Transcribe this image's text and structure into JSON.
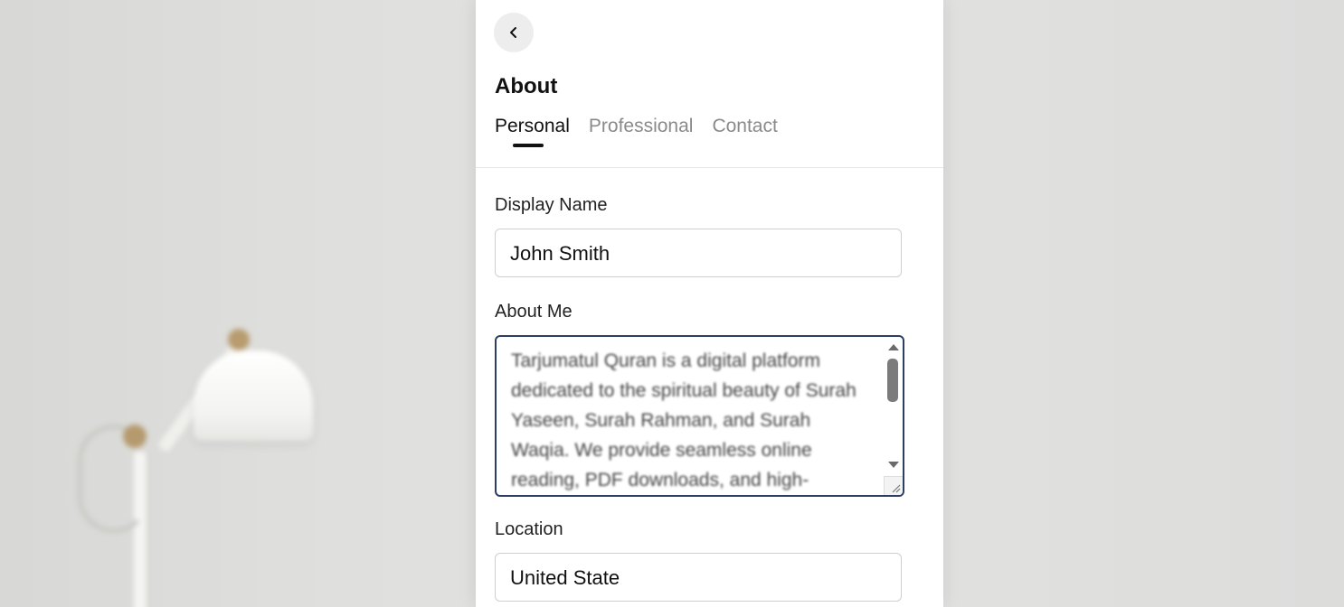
{
  "page": {
    "title": "About"
  },
  "tabs": [
    {
      "label": "Personal",
      "active": true
    },
    {
      "label": "Professional",
      "active": false
    },
    {
      "label": "Contact",
      "active": false
    }
  ],
  "form": {
    "display_name": {
      "label": "Display Name",
      "value": "John Smith"
    },
    "about_me": {
      "label": "About Me",
      "value": "Tarjumatul Quran is a digital platform dedicated to the spiritual beauty of Surah Yaseen, Surah Rahman, and Surah Waqia. We provide seamless online reading, PDF downloads, and high-"
    },
    "location": {
      "label": "Location",
      "value": "United State"
    }
  },
  "icons": {
    "back": "chevron-left-icon"
  },
  "colors": {
    "focus_border": "#2a3f63",
    "active_tab": "#111111",
    "inactive_tab": "#8a8a8a"
  }
}
